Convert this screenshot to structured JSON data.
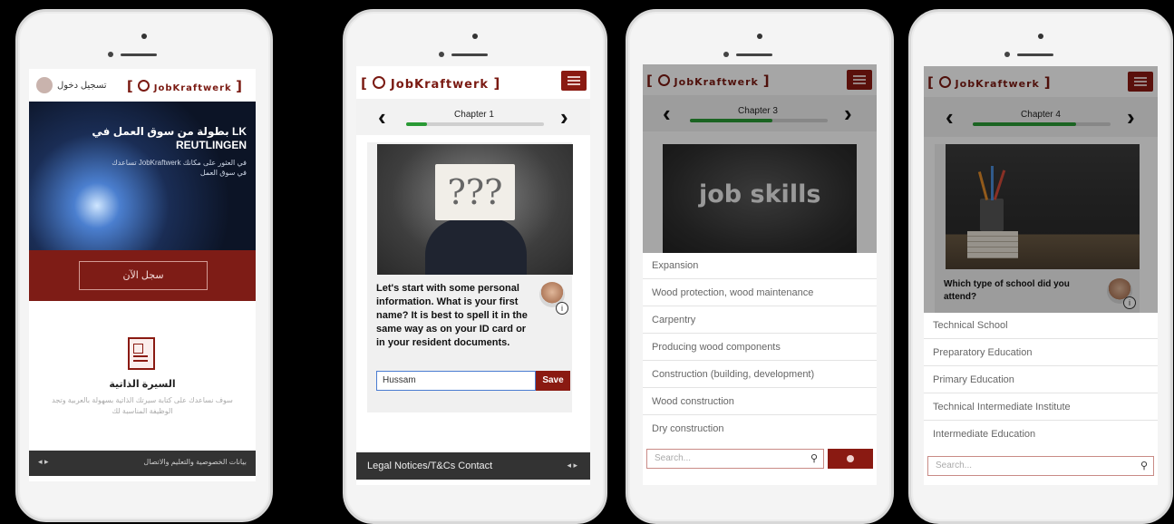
{
  "brand": {
    "name": "JobKraftwerk",
    "open_bracket": "[",
    "close_bracket": "]"
  },
  "colors": {
    "brand_red": "#8a1a12",
    "progress_green": "#2a9a35",
    "footer_dark": "#333333"
  },
  "screen1": {
    "login_link": "تسجيل دخول",
    "hero_title_line1": "بطولة من سوق العمل في LK",
    "hero_title_line2": "REUTLINGEN",
    "hero_sub": "تساعدك JobKraftwerk في العثور على مكانك في سوق العمل",
    "register_button": "سجل الآن",
    "feature_icon": "cv-document-icon",
    "feature_title": "السيرة الذاتية",
    "feature_text": "سوف نساعدك على كتابة سيرتك الذاتية بسهولة بالعربية وتجد الوظيفة المناسبة لك",
    "footer_text": "بيانات الخصوصية والتعليم والاتصال"
  },
  "screen2": {
    "chapter_label": "Chapter 1",
    "progress": 0.15,
    "image_icon": "question-marks-icon",
    "question": "Let's start with some personal information. What is your first name? It is best to spell it in the same way as on your ID card or in your resident documents.",
    "name_input_value": "Hussam",
    "save_button": "Save",
    "footer_text": "Legal Notices/T&Cs Contact"
  },
  "screen3": {
    "chapter_label": "Chapter 3",
    "progress": 0.6,
    "chalkboard_text": "job skills",
    "options": [
      "Expansion",
      "Wood protection, wood maintenance",
      "Carpentry",
      "Producing wood components",
      "Construction (building, development)",
      "Wood construction",
      "Dry construction"
    ],
    "search_placeholder": "Search..."
  },
  "screen4": {
    "chapter_label": "Chapter 4",
    "progress": 0.75,
    "question": "Which type of school did you attend?",
    "options": [
      "Technical School",
      "Preparatory Education",
      "Primary Education",
      "Technical Intermediate Institute",
      "Intermediate Education"
    ],
    "search_placeholder": "Search..."
  }
}
